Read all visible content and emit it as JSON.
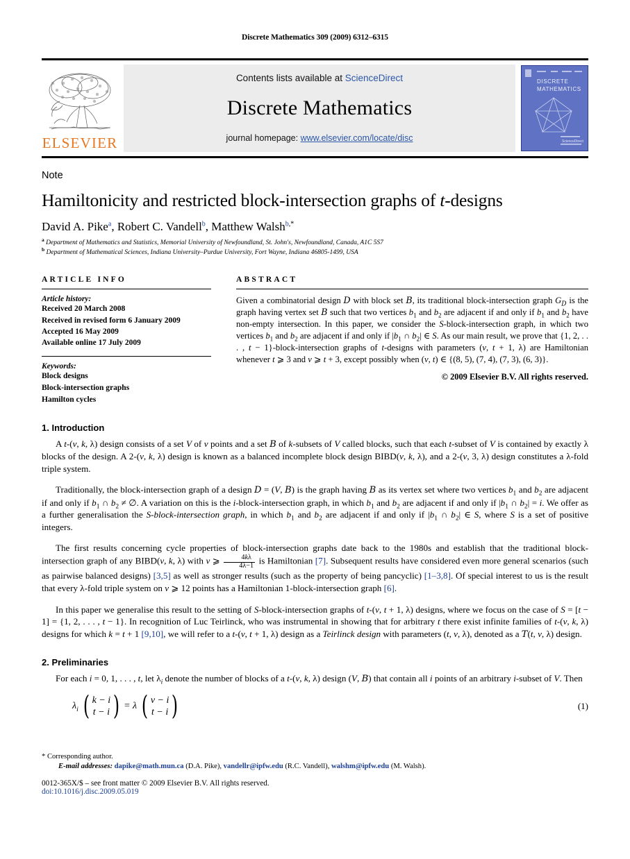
{
  "running_head": "Discrete Mathematics 309 (2009) 6312–6315",
  "masthead": {
    "publisher_wordmark": "ELSEVIER",
    "contents_prefix": "Contents lists available at ",
    "contents_link": "ScienceDirect",
    "journal_title": "Discrete Mathematics",
    "homepage_prefix": "journal homepage: ",
    "homepage_url": "www.elsevier.com/locate/disc",
    "cover": {
      "line1": "DISCRETE",
      "line2": "MATHEMATICS",
      "footer_mark": "ScienceDirect",
      "bg_color": "#5f72c4"
    },
    "link_color": "#2b57a8",
    "elsevier_orange": "#E87722"
  },
  "article": {
    "type_label": "Note",
    "title": "Hamiltonicity and restricted block-intersection graphs of t-designs",
    "authors": "David A. Pike a, Robert C. Vandell b, Matthew Walsh b,*",
    "affiliation_a": "Department of Mathematics and Statistics, Memorial University of Newfoundland, St. John's, Newfoundland, Canada, A1C 5S7",
    "affiliation_b": "Department of Mathematical Sciences, Indiana University–Purdue University, Fort Wayne, Indiana 46805-1499, USA"
  },
  "info": {
    "heading": "ARTICLE INFO",
    "history_label": "Article history:",
    "history": [
      "Received 20 March 2008",
      "Received in revised form 6 January 2009",
      "Accepted 16 May 2009",
      "Available online 17 July 2009"
    ],
    "keywords_label": "Keywords:",
    "keywords": [
      "Block designs",
      "Block-intersection graphs",
      "Hamilton cycles"
    ]
  },
  "abstract": {
    "heading": "ABSTRACT",
    "text": "Given a combinatorial design D with block set B, its traditional block-intersection graph GD is the graph having vertex set B such that two vertices b1 and b2 are adjacent if and only if b1 and b2 have non-empty intersection. In this paper, we consider the S-block-intersection graph, in which two vertices b1 and b2 are adjacent if and only if |b1 ∩ b2| ∈ S. As our main result, we prove that {1, 2, . . . , t − 1}-block-intersection graphs of t-designs with parameters (v, t + 1, λ) are Hamiltonian whenever t ⩾ 3 and v ⩾ t + 3, except possibly when (v, t) ∈ {(8, 5), (7, 4), (7, 3), (6, 3)}.",
    "copyright": "© 2009 Elsevier B.V. All rights reserved."
  },
  "sections": [
    {
      "number": "1.",
      "title": "Introduction"
    },
    {
      "number": "2.",
      "title": "Preliminaries"
    }
  ],
  "body": {
    "p1": "A t-(v, k, λ) design consists of a set V of v points and a set B of k-subsets of V called blocks, such that each t-subset of V is contained by exactly λ blocks of the design. A 2-(v, k, λ) design is known as a balanced incomplete block design BIBD(v, k, λ), and a 2-(v, 3, λ) design constitutes a λ-fold triple system.",
    "p2": "Traditionally, the block-intersection graph of a design D = (V, B) is the graph having B as its vertex set where two vertices b1 and b2 are adjacent if and only if b1 ∩ b2 ≠ ∅. A variation on this is the i-block-intersection graph, in which b1 and b2 are adjacent if and only if |b1 ∩ b2| = i. We offer as a further generalisation the S-block-intersection graph, in which b1 and b2 are adjacent if and only if |b1 ∩ b2| ∈ S, where S is a set of positive integers.",
    "p3": "The first results concerning cycle properties of block-intersection graphs date back to the 1980s and establish that the traditional block-intersection graph of any BIBD(v, k, λ) with v ⩾ 4kλ/(4λ−1) is Hamiltonian [7]. Subsequent results have considered even more general scenarios (such as pairwise balanced designs) [3,5] as well as stronger results (such as the property of being pancyclic) [1–3,8]. Of special interest to us is the result that every λ-fold triple system on v ⩾ 12 points has a Hamiltonian 1-block-intersection graph [6].",
    "p4": "In this paper we generalise this result to the setting of S-block-intersection graphs of t-(v, t + 1, λ) designs, where we focus on the case of S = [t − 1] = {1, 2, . . . , t − 1}. In recognition of Luc Teirlinck, who was instrumental in showing that for arbitrary t there exist infinite families of t-(v, k, λ) designs for which k = t + 1 [9,10], we will refer to a t-(v, t + 1, λ) design as a Teirlinck design with parameters (t, v, λ), denoted as a T(t, v, λ) design.",
    "p5": "For each i = 0, 1, . . . , t, let λi denote the number of blocks of a t-(v, k, λ) design (V, B) that contain all i points of an arbitrary i-subset of V. Then",
    "equation": {
      "lhs_symbol": "λi",
      "lhs_top": "k − i",
      "lhs_bottom": "t − i",
      "equals": "=",
      "rhs_symbol": "λ",
      "rhs_top": "v − i",
      "rhs_bottom": "t − i",
      "number": "(1)"
    }
  },
  "footer": {
    "corresponding": "* Corresponding author.",
    "email_label": "E-mail addresses:",
    "emails": [
      {
        "address": "dapike@math.mun.ca",
        "who": "(D.A. Pike)"
      },
      {
        "address": "vandellr@ipfw.edu",
        "who": "(R.C. Vandell)"
      },
      {
        "address": "walshm@ipfw.edu",
        "who": "(M. Walsh)"
      }
    ],
    "imprint": "0012-365X/$ – see front matter © 2009 Elsevier B.V. All rights reserved.",
    "doi": "doi:10.1016/j.disc.2009.05.019",
    "link_color": "#1c3f94"
  }
}
